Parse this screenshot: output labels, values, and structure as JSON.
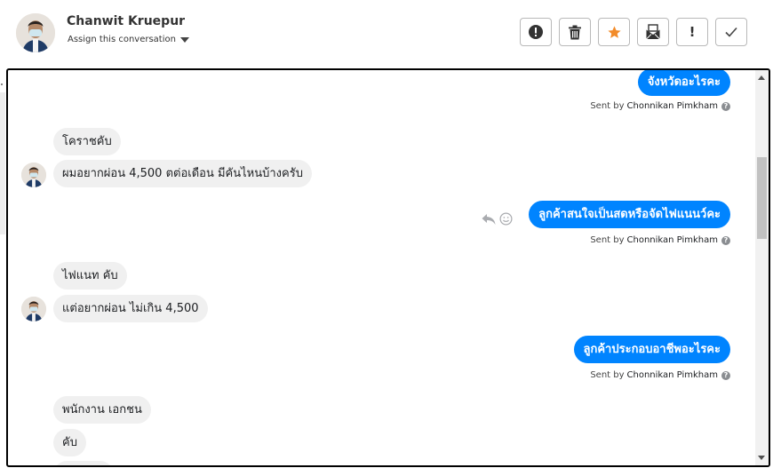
{
  "header": {
    "contact_name": "Chanwit Kruepur",
    "assign_label": "Assign this conversation",
    "actions": [
      {
        "name": "spam-button",
        "icon": "alert-circle-icon"
      },
      {
        "name": "delete-button",
        "icon": "trash-icon"
      },
      {
        "name": "star-button",
        "icon": "star-icon"
      },
      {
        "name": "mark-unread-button",
        "icon": "envelope-icon"
      },
      {
        "name": "follow-up-button",
        "icon": "exclamation-icon",
        "label": "!"
      },
      {
        "name": "mark-done-button",
        "icon": "checkmark-icon"
      }
    ]
  },
  "conversation": {
    "sent_by_prefix": "Sent by",
    "agent_name": "Chonnikan Pimkham",
    "help_glyph": "?",
    "messages": [
      {
        "dir": "out",
        "text": "จังหวัดอะไรคะ"
      },
      {
        "dir": "in",
        "text": "โคราชคับ"
      },
      {
        "dir": "in",
        "text": "ผมอยากผ่อน 4,500 ตต่อเดือน มีคันไหนบ้างครับ"
      },
      {
        "dir": "out",
        "text": "ลูกค้าสนใจเป็นสดหรือจัดไฟแนนว์คะ"
      },
      {
        "dir": "in",
        "text": "ไฟแนท คับ"
      },
      {
        "dir": "in",
        "text": "แต่อยากผ่อน ไม่เกิน 4,500"
      },
      {
        "dir": "out",
        "text": "ลูกค้าประกอบอาชีพอะไรคะ"
      },
      {
        "dir": "in",
        "text": "พนักงาน เอกชน"
      },
      {
        "dir": "in",
        "text": "คับ"
      }
    ]
  },
  "colors": {
    "accent": "#0084ff",
    "incoming_bubble": "#f0f0f0",
    "star": "#f28b29"
  }
}
